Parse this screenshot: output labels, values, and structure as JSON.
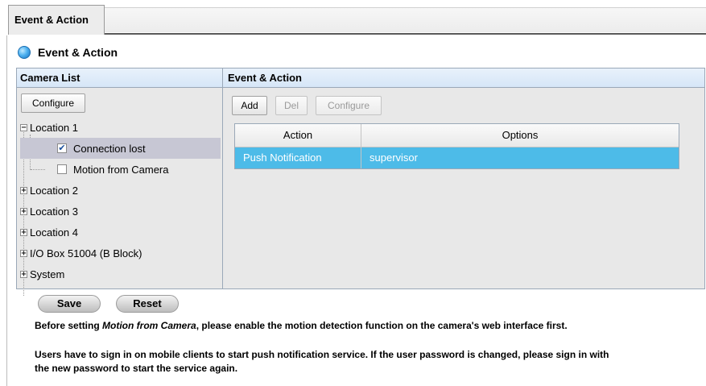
{
  "tab": {
    "label": "Event & Action"
  },
  "section": {
    "title": "Event & Action"
  },
  "camera_list": {
    "header": "Camera List",
    "configure_label": "Configure",
    "tree": [
      {
        "label": "Location 1",
        "expanded": true
      },
      {
        "label": "Connection lost",
        "checked": true,
        "selected": true
      },
      {
        "label": "Motion from Camera",
        "checked": false
      },
      {
        "label": "Location 2",
        "expanded": false
      },
      {
        "label": "Location 3",
        "expanded": false
      },
      {
        "label": "Location 4",
        "expanded": false
      },
      {
        "label": "I/O Box 51004 (B Block)",
        "expanded": false
      },
      {
        "label": "System",
        "expanded": false
      }
    ]
  },
  "event_action": {
    "header": "Event & Action",
    "add_label": "Add",
    "del_label": "Del",
    "configure_label": "Configure",
    "columns": [
      "Action",
      "Options"
    ],
    "rows": [
      {
        "action": "Push Notification",
        "options": "supervisor"
      }
    ]
  },
  "footer": {
    "save_label": "Save",
    "reset_label": "Reset",
    "note1_prefix": "Before setting ",
    "note1_em": "Motion from Camera",
    "note1_suffix": ", please enable the motion detection function on the camera's web interface first.",
    "note2_line1": "Users have to sign in on mobile clients to start push notification service. If the user password is changed, please sign in with",
    "note2_line2": "the new password to start the service again."
  },
  "colors": {
    "selected_row": "#4dbbe8",
    "tree_selection": "#c7c7d4",
    "panel_header": "#d6e6f7"
  }
}
